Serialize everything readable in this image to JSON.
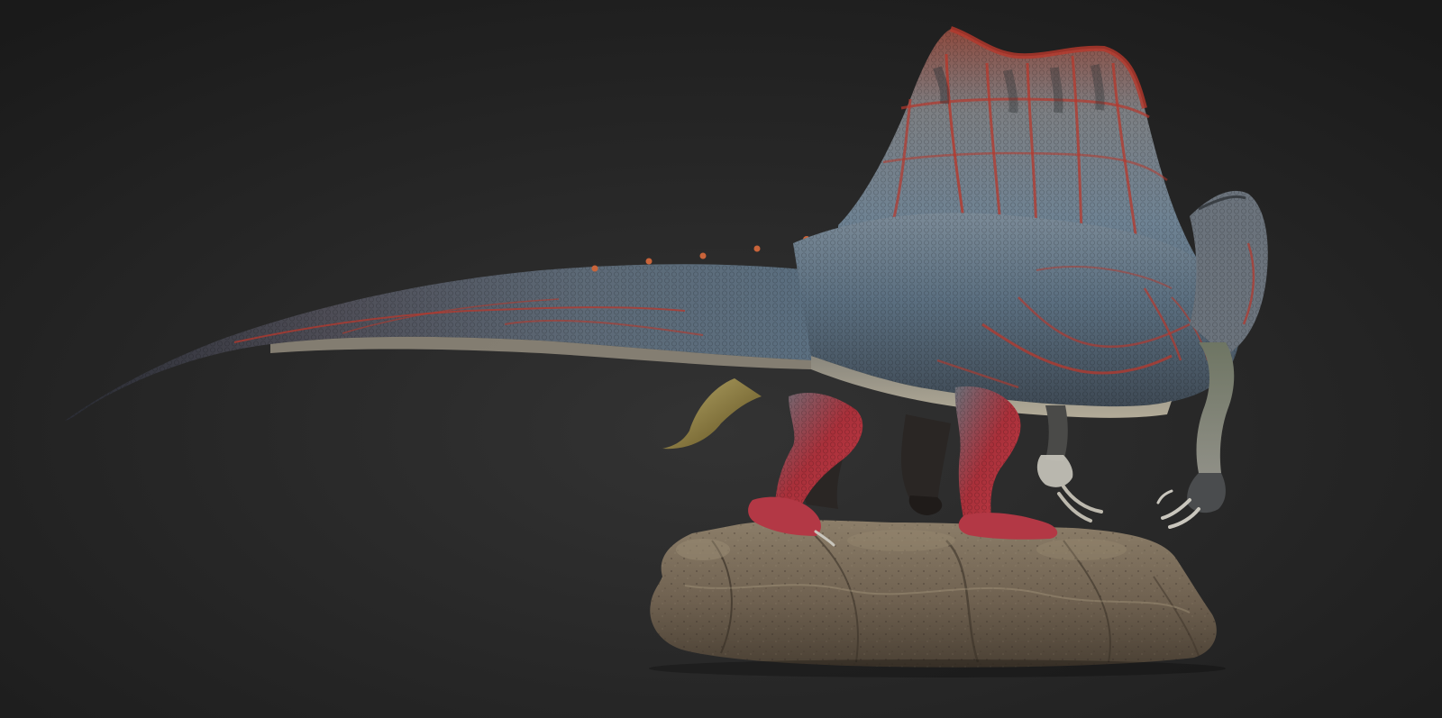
{
  "scene": {
    "subject": "",
    "background": {
      "top_color": "#1c1c1c",
      "bottom_color": "#2e2e2e"
    },
    "colors": {
      "sail_red": "#b8382c",
      "body_blue": "#5b6f80",
      "skin_grey": "#7d7a74",
      "belly_tan": "#a59e8c",
      "leg_red": "#a9303a",
      "rock_brown": "#6f6150",
      "rock_light": "#8c7e69",
      "claw_pale": "#c9c6bd",
      "spine_orange": "#c9643a",
      "dark_limb": "#2a2624",
      "yellow_fin": "#9c8a3a"
    }
  }
}
